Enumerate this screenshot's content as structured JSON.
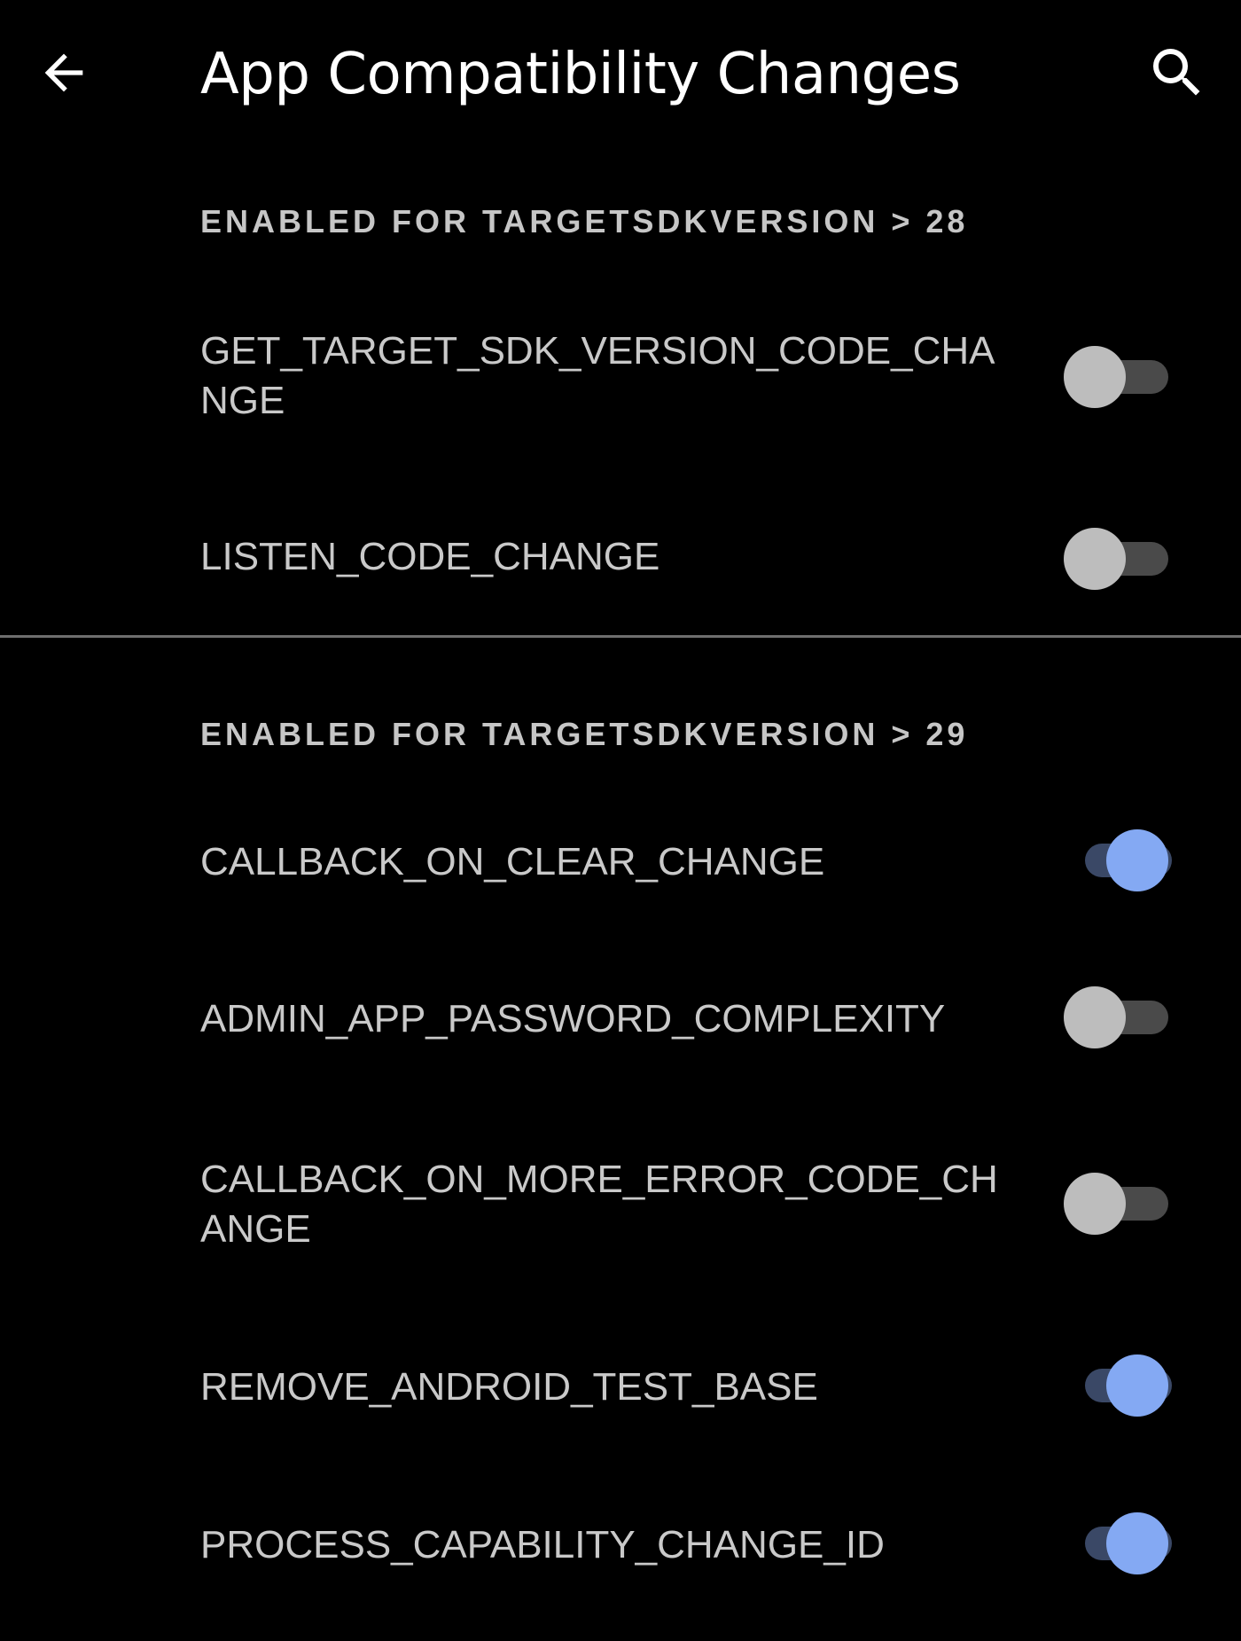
{
  "header": {
    "title": "App Compatibility Changes",
    "back_icon": "arrow-left-icon",
    "search_icon": "search-icon"
  },
  "colors": {
    "background": "#000000",
    "switch_on_thumb": "#84a9f3",
    "switch_on_track": "#3a4866",
    "switch_off_thumb": "#bdbdbd",
    "switch_off_track": "#4a4a4a"
  },
  "sections": [
    {
      "header": "ENABLED FOR TARGETSDKVERSION > 28",
      "items": [
        {
          "label": "GET_TARGET_SDK_VERSION_CODE_CHANGE",
          "enabled": false
        },
        {
          "label": "LISTEN_CODE_CHANGE",
          "enabled": false
        }
      ]
    },
    {
      "header": "ENABLED FOR TARGETSDKVERSION > 29",
      "items": [
        {
          "label": "CALLBACK_ON_CLEAR_CHANGE",
          "enabled": true
        },
        {
          "label": "ADMIN_APP_PASSWORD_COMPLEXITY",
          "enabled": false
        },
        {
          "label": "CALLBACK_ON_MORE_ERROR_CODE_CHANGE",
          "enabled": false
        },
        {
          "label": "REMOVE_ANDROID_TEST_BASE",
          "enabled": true
        },
        {
          "label": "PROCESS_CAPABILITY_CHANGE_ID",
          "enabled": true
        }
      ]
    }
  ]
}
